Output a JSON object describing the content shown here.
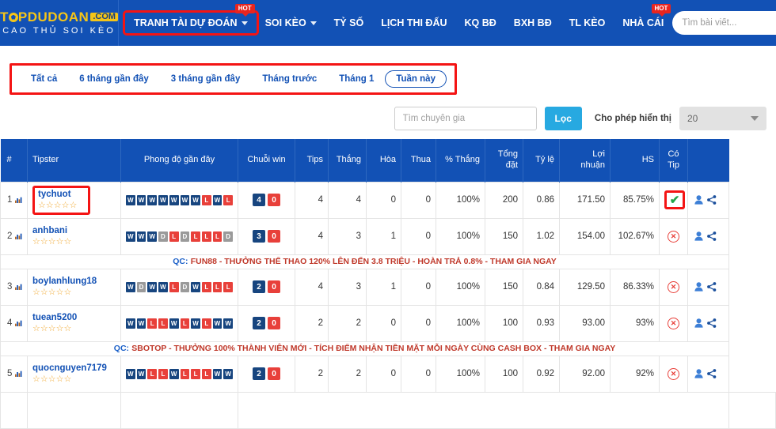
{
  "header": {
    "logo": {
      "main": "T",
      "main_rest": "PDUDOAN",
      "com": ".COM",
      "sub": "CAO THỦ SOI KÈO"
    },
    "nav": [
      {
        "label": "TRANH TÀI DỰ ĐOÁN",
        "caret": true,
        "badge": "HOT",
        "highlight": true
      },
      {
        "label": "SOI KÈO",
        "caret": true,
        "badge": "",
        "highlight": false
      },
      {
        "label": "TỶ SỐ",
        "caret": false,
        "badge": "",
        "highlight": false
      },
      {
        "label": "LỊCH THI ĐẤU",
        "caret": false,
        "badge": "",
        "highlight": false
      },
      {
        "label": "KQ BĐ",
        "caret": false,
        "badge": "",
        "highlight": false
      },
      {
        "label": "BXH BĐ",
        "caret": false,
        "badge": "",
        "highlight": false
      },
      {
        "label": "TL KÈO",
        "caret": false,
        "badge": "",
        "highlight": false
      },
      {
        "label": "NHÀ CÁI",
        "caret": false,
        "badge": "HOT",
        "highlight": false
      }
    ],
    "search_placeholder": "Tìm bài viết...",
    "search_value": ""
  },
  "filters": {
    "tabs": [
      {
        "label": "Tất cả",
        "active": false
      },
      {
        "label": "6 tháng gần đây",
        "active": false
      },
      {
        "label": "3 tháng gần đây",
        "active": false
      },
      {
        "label": "Tháng trước",
        "active": false
      },
      {
        "label": "Tháng 1",
        "active": false
      },
      {
        "label": "Tuần này",
        "active": true
      }
    ]
  },
  "tools": {
    "expert_placeholder": "Tìm chuyên gia",
    "expert_value": "",
    "filter_button": "Lọc",
    "allow_display_label": "Cho phép hiển thị",
    "page_size": "20"
  },
  "table": {
    "headers": {
      "rank": "#",
      "tipster": "Tipster",
      "form": "Phong độ gần đây",
      "streak": "Chuỗi win",
      "tips": "Tips",
      "thang": "Thắng",
      "hoa": "Hòa",
      "thua": "Thua",
      "pct": "% Thắng",
      "tong_l1": "Tổng",
      "tong_l2": "đặt",
      "tyle": "Tỷ lệ",
      "loi_l1": "Lợi",
      "loi_l2": "nhuận",
      "hs": "HS",
      "tip_l1": "Có",
      "tip_l2": "Tip"
    },
    "rows": [
      {
        "rank": "1",
        "name": "tychuot",
        "stars": "☆☆☆☆☆",
        "highlight_name": true,
        "form": [
          "W",
          "W",
          "W",
          "W",
          "W",
          "W",
          "W",
          "L",
          "W",
          "L"
        ],
        "streak_win": "4",
        "streak_loss": "0",
        "tips": "4",
        "thang": "4",
        "hoa": "0",
        "thua": "0",
        "pct": "100%",
        "tong": "200",
        "tyle": "0.86",
        "loi": "171.50",
        "hs": "85.75%",
        "has_tip": true,
        "highlight_tip": true
      },
      {
        "rank": "2",
        "name": "anhbani",
        "stars": "☆☆☆☆☆",
        "highlight_name": false,
        "form": [
          "W",
          "W",
          "W",
          "D",
          "L",
          "D",
          "L",
          "L",
          "L",
          "D"
        ],
        "streak_win": "3",
        "streak_loss": "0",
        "tips": "4",
        "thang": "3",
        "hoa": "1",
        "thua": "0",
        "pct": "100%",
        "tong": "150",
        "tyle": "1.02",
        "loi": "154.00",
        "hs": "102.67%",
        "has_tip": false,
        "highlight_tip": false
      },
      {
        "rank": "3",
        "name": "boylanhlung18",
        "stars": "☆☆☆☆☆",
        "highlight_name": false,
        "form": [
          "W",
          "D",
          "W",
          "W",
          "L",
          "D",
          "W",
          "L",
          "L",
          "L"
        ],
        "streak_win": "2",
        "streak_loss": "0",
        "tips": "4",
        "thang": "3",
        "hoa": "1",
        "thua": "0",
        "pct": "100%",
        "tong": "150",
        "tyle": "0.84",
        "loi": "129.50",
        "hs": "86.33%",
        "has_tip": false,
        "highlight_tip": false
      },
      {
        "rank": "4",
        "name": "tuean5200",
        "stars": "☆☆☆☆☆",
        "highlight_name": false,
        "form": [
          "W",
          "W",
          "L",
          "L",
          "W",
          "L",
          "W",
          "L",
          "W",
          "W"
        ],
        "streak_win": "2",
        "streak_loss": "0",
        "tips": "2",
        "thang": "2",
        "hoa": "0",
        "thua": "0",
        "pct": "100%",
        "tong": "100",
        "tyle": "0.93",
        "loi": "93.00",
        "hs": "93%",
        "has_tip": false,
        "highlight_tip": false
      },
      {
        "rank": "5",
        "name": "quocnguyen7179",
        "stars": "☆☆☆☆☆",
        "highlight_name": false,
        "form": [
          "W",
          "W",
          "L",
          "L",
          "W",
          "L",
          "L",
          "L",
          "W",
          "W"
        ],
        "streak_win": "2",
        "streak_loss": "0",
        "tips": "2",
        "thang": "2",
        "hoa": "0",
        "thua": "0",
        "pct": "100%",
        "tong": "100",
        "tyle": "0.92",
        "loi": "92.00",
        "hs": "92%",
        "has_tip": false,
        "highlight_tip": false
      }
    ],
    "ads": [
      {
        "after_row": 2,
        "prefix": "QC:",
        "text": "FUN88 - THƯỞNG THỂ THAO 120% LÊN ĐẾN 3.8 TRIỆU - HOÀN TRẢ 0.8% - THAM GIA NGAY"
      },
      {
        "after_row": 4,
        "prefix": "QC:",
        "text": "SBOTOP - THƯỞNG 100% THÀNH VIÊN MỚI - TÍCH ĐIỂM NHẬN TIỀN MẶT MỖI NGÀY CÙNG CASH BOX - THAM GIA NGAY"
      }
    ]
  },
  "colors": {
    "brand_blue": "#1251b5",
    "accent_yellow": "#f5c518",
    "red": "#e8403a",
    "highlight_red": "#f41414",
    "green": "#22a54a",
    "cyan": "#27a9e1"
  }
}
